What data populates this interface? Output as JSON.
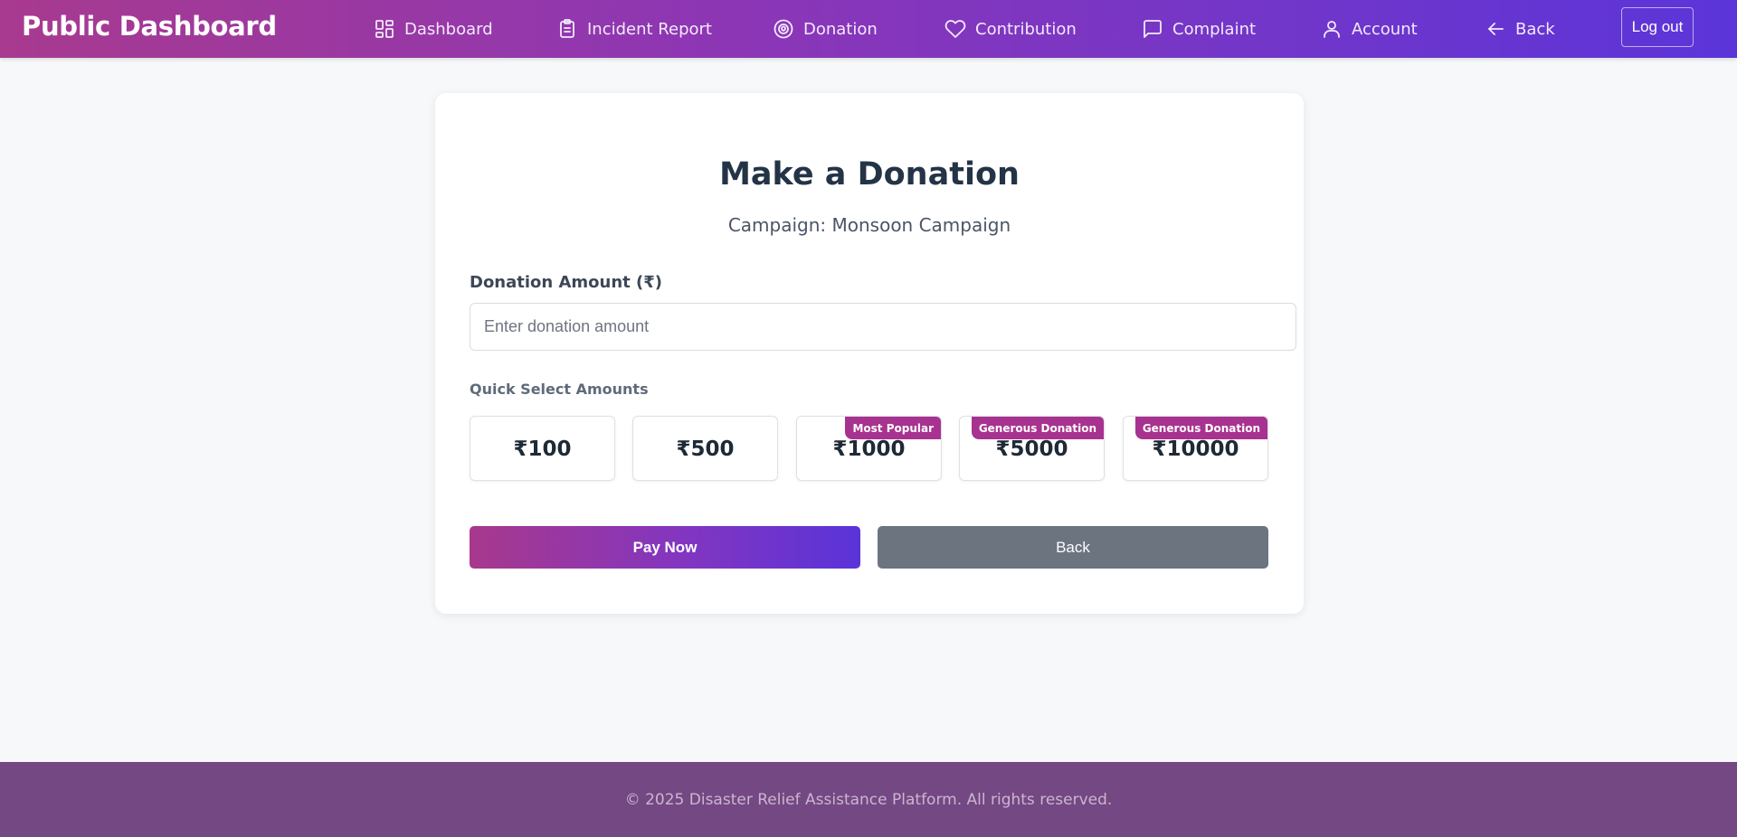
{
  "header": {
    "brand": "Public Dashboard",
    "nav": [
      {
        "label": "Dashboard",
        "icon": "dashboard-grid-icon"
      },
      {
        "label": "Incident Report",
        "icon": "clipboard-icon"
      },
      {
        "label": "Donation",
        "icon": "donation-icon"
      },
      {
        "label": "Contribution",
        "icon": "heart-icon"
      },
      {
        "label": "Complaint",
        "icon": "message-square-icon"
      },
      {
        "label": "Account",
        "icon": "user-icon"
      },
      {
        "label": "Back",
        "icon": "arrow-left-icon"
      }
    ],
    "logout_label": "Log out"
  },
  "form": {
    "title": "Make a Donation",
    "campaign": "Campaign: Monsoon Campaign",
    "amount_label": "Donation Amount (₹)",
    "amount_placeholder": "Enter donation amount",
    "amount_value": "",
    "quick_label": "Quick Select Amounts",
    "quick_amounts": [
      {
        "label": "₹100",
        "badge": ""
      },
      {
        "label": "₹500",
        "badge": ""
      },
      {
        "label": "₹1000",
        "badge": "Most Popular"
      },
      {
        "label": "₹5000",
        "badge": "Generous Donation"
      },
      {
        "label": "₹10000",
        "badge": "Generous Donation"
      }
    ],
    "pay_label": "Pay Now",
    "back_label": "Back"
  },
  "footer": {
    "text": "© 2025 Disaster Relief Assistance Platform. All rights reserved."
  },
  "colors": {
    "header_gradient_start": "#a83a8f",
    "header_gradient_end": "#5b35d9",
    "badge": "#a8328f",
    "back_button": "#6c7480",
    "footer": "#744882"
  }
}
